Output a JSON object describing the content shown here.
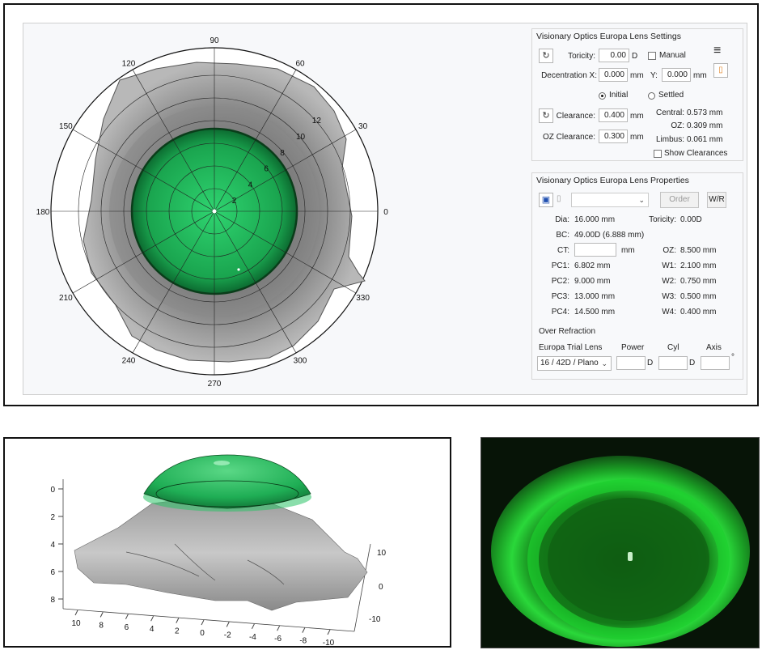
{
  "polar_map": {
    "angle_labels": [
      "90",
      "60",
      "30",
      "0",
      "330",
      "300",
      "270",
      "240",
      "210",
      "180",
      "150",
      "120"
    ],
    "ring_labels": [
      "2",
      "4",
      "6",
      "8",
      "10",
      "12"
    ]
  },
  "settings": {
    "title": "Visionary Optics Europa Lens Settings",
    "toricity_label": "Toricity:",
    "toricity_value": "0.00",
    "toricity_unit": "D",
    "manual_label": "Manual",
    "decentration_label": "Decentration X:",
    "decentration_x": "0.000",
    "mm": "mm",
    "y_label": "Y:",
    "decentration_y": "0.000",
    "initial_label": "Initial",
    "settled_label": "Settled",
    "clearance_label": "Clearance:",
    "clearance_value": "0.400",
    "oz_clearance_label": "OZ Clearance:",
    "oz_clearance_value": "0.300",
    "central_label": "Central:",
    "central_value": "0.573 mm",
    "oz_label": "OZ:",
    "oz_value": "0.309 mm",
    "limbus_label": "Limbus:",
    "limbus_value": "0.061 mm",
    "show_clearances_label": "Show Clearances"
  },
  "properties": {
    "title": "Visionary Optics Europa Lens Properties",
    "order_label": "Order",
    "wr_label": "W/R",
    "dia_label": "Dia:",
    "dia_value": "16.000 mm",
    "toricity_label": "Toricity:",
    "toricity_value": "0.00D",
    "bc_label": "BC:",
    "bc_value": "49.00D (6.888 mm)",
    "ct_label": "CT:",
    "ct_unit": "mm",
    "oz_label": "OZ:",
    "oz_value": "8.500 mm",
    "pc1_label": "PC1:",
    "pc1_value": "6.802 mm",
    "w1_label": "W1:",
    "w1_value": "2.100 mm",
    "pc2_label": "PC2:",
    "pc2_value": "9.000 mm",
    "w2_label": "W2:",
    "w2_value": "0.750 mm",
    "pc3_label": "PC3:",
    "pc3_value": "13.000 mm",
    "w3_label": "W3:",
    "w3_value": "0.500 mm",
    "pc4_label": "PC4:",
    "pc4_value": "14.500 mm",
    "w4_label": "W4:",
    "w4_value": "0.400 mm",
    "over_refraction_label": "Over Refraction",
    "trial_lens_label": "Europa Trial Lens",
    "trial_lens_value": "16 / 42D / Plano",
    "power_label": "Power",
    "cyl_label": "Cyl",
    "axis_label": "Axis",
    "d_unit": "D",
    "deg_unit": "°"
  },
  "plot3d": {
    "y_ticks": [
      "0",
      "2",
      "4",
      "6",
      "8"
    ],
    "x_ticks": [
      "10",
      "8",
      "6",
      "4",
      "2",
      "0",
      "-2",
      "-4",
      "-6",
      "-8",
      "-10"
    ],
    "z_ticks": [
      "10",
      "0",
      "-10"
    ]
  },
  "colors": {
    "lens_green": "#1fb85a",
    "fluorescein": "#22dd44"
  }
}
